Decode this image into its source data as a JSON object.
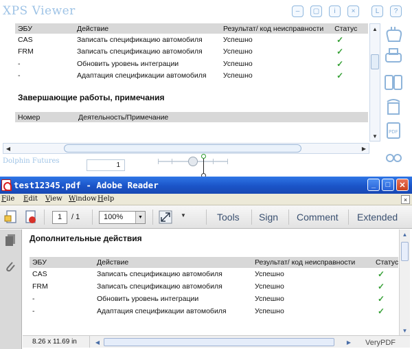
{
  "xps_viewer": {
    "title": "XPS Viewer",
    "brand": "Dolphin Futures",
    "page_number": "1",
    "table_headers": [
      "ЭБУ",
      "Действие",
      "Результат/ код неисправности",
      "Статус"
    ],
    "rows": [
      {
        "ecu": "CAS",
        "action": "Записать спецификацию автомобиля",
        "result": "Успешно",
        "status": "✓"
      },
      {
        "ecu": "FRM",
        "action": "Записать спецификацию автомобиля",
        "result": "Успешно",
        "status": "✓"
      },
      {
        "ecu": "-",
        "action": "Обновить уровень интеграции",
        "result": "Успешно",
        "status": "✓"
      },
      {
        "ecu": "-",
        "action": "Адаптация спецификации автомобиля",
        "result": "Успешно",
        "status": "✓"
      }
    ],
    "section_title": "Завершающие работы, примечания",
    "section_headers": [
      "Номер",
      "Деятельность/Примечание"
    ],
    "window_buttons": {
      "minimize": "–",
      "restore": "▢",
      "info": "i",
      "close": "×",
      "l_btn": "L",
      "help": "?"
    }
  },
  "adobe_reader": {
    "title": "test12345.pdf - Adobe Reader",
    "menu": [
      "File",
      "Edit",
      "View",
      "Window",
      "Help"
    ],
    "page_current": "1",
    "page_total": "/ 1",
    "zoom": "100%",
    "toolbar_links": [
      "Tools",
      "Sign",
      "Comment",
      "Extended"
    ],
    "section_title": "Дополнительные действия",
    "table_headers": [
      "ЭБУ",
      "Действие",
      "Результат/ код неисправности",
      "Статус"
    ],
    "rows": [
      {
        "ecu": "CAS",
        "action": "Записать спецификацию автомобиля",
        "result": "Успешно",
        "status": "✓"
      },
      {
        "ecu": "FRM",
        "action": "Записать спецификацию автомобиля",
        "result": "Успешно",
        "status": "✓"
      },
      {
        "ecu": "-",
        "action": "Обновить уровень интеграции",
        "result": "Успешно",
        "status": "✓"
      },
      {
        "ecu": "-",
        "action": "Адаптация спецификации автомобиля",
        "result": "Успешно",
        "status": "✓"
      }
    ],
    "page_size": "8.26 x 11.69 in",
    "watermark": "VeryPDF",
    "win_buttons": {
      "minimize": "_",
      "maximize": "□",
      "close": "✕",
      "menu_close": "×"
    }
  },
  "colors": {
    "xps_accent": "#9ec3e6",
    "check": "#36a036",
    "reader_title": "#1b54c8"
  }
}
